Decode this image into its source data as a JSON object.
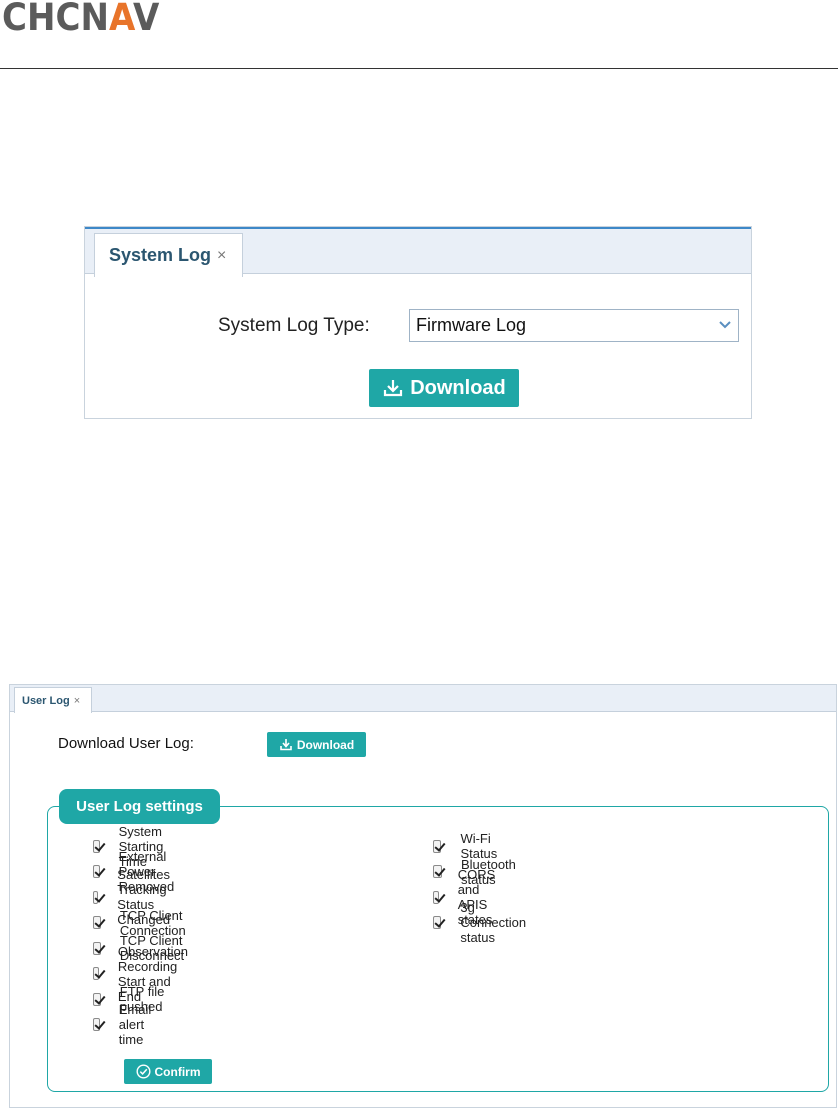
{
  "header": {
    "logo_text": "CHCNAV",
    "logo_prefix": "CHCN",
    "logo_mark": "A",
    "logo_suffix": "V",
    "brand_color": "#e8742a"
  },
  "system_log_panel": {
    "tab_label": "System Log",
    "tab_close": "×",
    "type_label": "System Log Type:",
    "type_value": "Firmware Log",
    "download_label": "Download",
    "download_icon": "download-icon",
    "chevron_icon": "chevron-down-icon"
  },
  "user_log_panel": {
    "tab_label": "User Log",
    "tab_close": "×",
    "download_label_text": "Download User Log:",
    "download_button_label": "Download",
    "settings_title": "User Log settings",
    "left_items": [
      {
        "label": "System Starting Time",
        "checked": true
      },
      {
        "label": "External Power Removed",
        "checked": true
      },
      {
        "label": "Satellites Tracking Status Changed",
        "checked": true
      },
      {
        "label": "TCP Client Connection",
        "checked": true
      },
      {
        "label": "TCP Client Disconnect",
        "checked": true
      },
      {
        "label": "Observation Recording Start and End",
        "checked": true
      },
      {
        "label": "FTP file pushed",
        "checked": true
      },
      {
        "label": "Email alert time",
        "checked": true
      }
    ],
    "right_items": [
      {
        "label": "Wi-Fi Status",
        "checked": true
      },
      {
        "label": "Bluetooth status",
        "checked": true
      },
      {
        "label": "CORS and APIS states",
        "checked": true
      },
      {
        "label": "3g Connection status",
        "checked": true
      }
    ],
    "confirm_label": "Confirm",
    "accent_color": "#1fa7a6"
  }
}
